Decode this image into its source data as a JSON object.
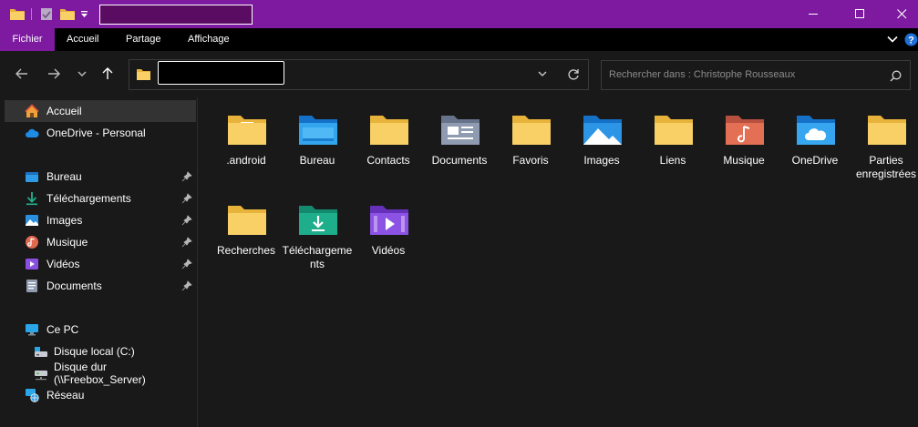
{
  "ribbon": {
    "tabs": [
      {
        "label": "Fichier",
        "active": true
      },
      {
        "label": "Accueil"
      },
      {
        "label": "Partage"
      },
      {
        "label": "Affichage"
      }
    ]
  },
  "search": {
    "placeholder": "Rechercher dans : Christophe Rousseaux"
  },
  "sidebar": {
    "quick": [
      {
        "label": "Accueil",
        "icon": "home-icon",
        "selected": true
      },
      {
        "label": "OneDrive - Personal",
        "icon": "cloud-icon"
      }
    ],
    "pinned": [
      {
        "label": "Bureau",
        "icon": "desktop-folder-icon"
      },
      {
        "label": "Téléchargements",
        "icon": "download-icon"
      },
      {
        "label": "Images",
        "icon": "images-icon"
      },
      {
        "label": "Musique",
        "icon": "music-icon"
      },
      {
        "label": "Vidéos",
        "icon": "videos-icon"
      },
      {
        "label": "Documents",
        "icon": "documents-icon"
      }
    ],
    "pc": {
      "label": "Ce PC",
      "icon": "pc-icon"
    },
    "drives": [
      {
        "label": "Disque local (C:)",
        "icon": "local-drive-icon"
      },
      {
        "label": "Disque dur (\\\\Freebox_Server)",
        "icon": "network-drive-icon"
      }
    ],
    "network": {
      "label": "Réseau",
      "icon": "network-icon"
    }
  },
  "folders": [
    {
      "label": ".android",
      "icon": "folder-icon"
    },
    {
      "label": "Bureau",
      "icon": "desktop-folder-icon"
    },
    {
      "label": "Contacts",
      "icon": "folder-icon"
    },
    {
      "label": "Documents",
      "icon": "documents-folder-icon"
    },
    {
      "label": "Favoris",
      "icon": "folder-icon"
    },
    {
      "label": "Images",
      "icon": "images-folder-icon"
    },
    {
      "label": "Liens",
      "icon": "folder-icon"
    },
    {
      "label": "Musique",
      "icon": "music-folder-icon"
    },
    {
      "label": "OneDrive",
      "icon": "onedrive-folder-icon"
    },
    {
      "label": "Parties enregistrées",
      "icon": "folder-icon"
    },
    {
      "label": "Recherches",
      "icon": "folder-icon"
    },
    {
      "label": "Téléchargements",
      "icon": "downloads-folder-icon"
    },
    {
      "label": "Vidéos",
      "icon": "videos-folder-icon"
    }
  ],
  "colors": {
    "titlebar": "#7d1aa0",
    "background": "#191919",
    "folder": "#f6c94a"
  }
}
